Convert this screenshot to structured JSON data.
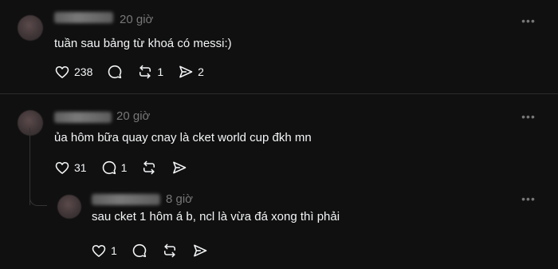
{
  "posts": [
    {
      "time": "20 giờ",
      "text": "tuần sau bảng từ khoá có messi:)",
      "likes": "238",
      "replies": "",
      "reposts": "1",
      "shares": "2"
    },
    {
      "time": "20 giờ",
      "text": "ủa hôm bữa quay cnay là cket world cup đkh mn",
      "likes": "31",
      "replies": "1",
      "reposts": "",
      "shares": ""
    },
    {
      "time": "8 giờ",
      "text": "sau cket 1 hôm á b, ncl là vừa đá xong thì phải",
      "likes": "1",
      "replies": "",
      "reposts": "",
      "shares": ""
    }
  ],
  "icons": {
    "like": "heart-icon",
    "reply": "comment-icon",
    "repost": "repost-icon",
    "share": "share-icon",
    "more": "more-icon"
  },
  "colors": {
    "background": "#101010",
    "text": "#f3f5f7",
    "muted": "#777777",
    "divider": "#2b2b2b"
  }
}
